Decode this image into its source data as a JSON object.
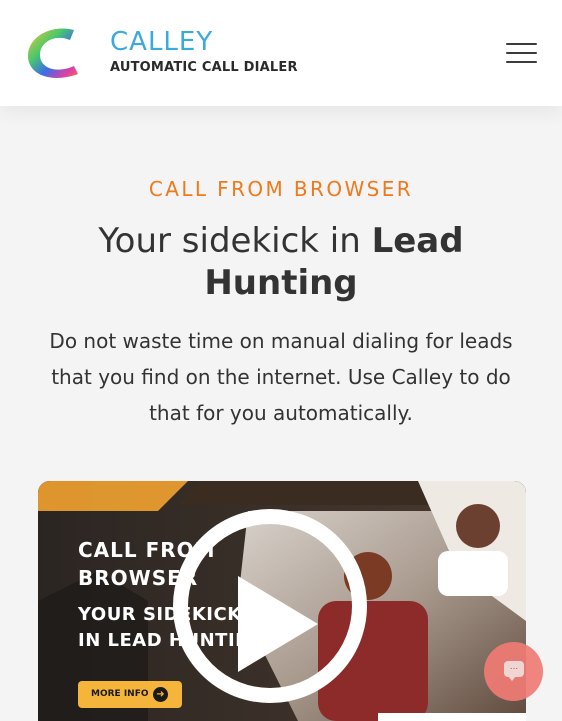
{
  "header": {
    "logo": {
      "title": "CALLEY",
      "subtitle": "AUTOMATIC CALL DIALER",
      "icon": "calley-c-logo-icon"
    },
    "menu_icon": "hamburger-menu-icon"
  },
  "hero": {
    "eyebrow": "CALL FROM BROWSER",
    "headline_light": "Your sidekick in ",
    "headline_bold": "Lead Hunting",
    "description": "Do not waste time on manual dialing for leads that you find on the internet. Use Calley to do that for you automatically."
  },
  "video": {
    "line1": "CALL FROM",
    "line2": "BROWSER",
    "line3": "YOUR SIDEKICK",
    "line4": "IN LEAD HUNTING",
    "more_info_label": "MORE INFO",
    "play_icon": "play-icon"
  },
  "chat": {
    "icon": "chat-bubble-icon",
    "bubble_text": "..."
  },
  "colors": {
    "accent": "#ee7a1c",
    "logo_blue": "#3aa9dd",
    "text": "#333333",
    "background": "#f4f4f4",
    "more_info": "#f4b53a",
    "chat": "#f07b74"
  }
}
